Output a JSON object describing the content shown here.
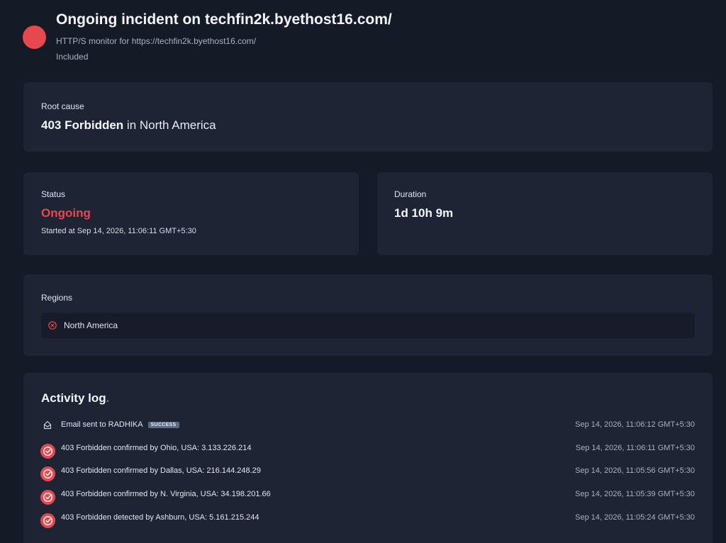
{
  "header": {
    "title": "Ongoing incident on techfin2k.byethost16.com/",
    "subtitle": "HTTP/S monitor for https://techfin2k.byethost16.com/",
    "included": "Included",
    "status_color": "#e5484d"
  },
  "root_cause": {
    "label": "Root cause",
    "error": "403 Forbidden",
    "connector": "in",
    "region": "North America"
  },
  "status": {
    "label": "Status",
    "value": "Ongoing",
    "started_at": "Started at Sep 14, 2026, 11:06:11 GMT+5:30",
    "color": "#e5484d"
  },
  "duration": {
    "label": "Duration",
    "value": "1d 10h 9m"
  },
  "regions": {
    "label": "Regions",
    "items": [
      {
        "name": "North America",
        "icon": "x-circle-icon"
      }
    ]
  },
  "activity_log": {
    "title": "Activity log",
    "title_suffix": ".",
    "items": [
      {
        "icon": "mail-icon",
        "text": "Email sent to RADHIKA",
        "badge": "SUCCESS",
        "time": "Sep 14, 2026, 11:06:12 GMT+5:30"
      },
      {
        "icon": "check-circle-icon",
        "text": "403 Forbidden confirmed by Ohio, USA: 3.133.226.214",
        "time": "Sep 14, 2026, 11:06:11 GMT+5:30"
      },
      {
        "icon": "check-circle-icon",
        "text": "403 Forbidden confirmed by Dallas, USA: 216.144.248.29",
        "time": "Sep 14, 2026, 11:05:56 GMT+5:30"
      },
      {
        "icon": "check-circle-icon",
        "text": "403 Forbidden confirmed by N. Virginia, USA: 34.198.201.66",
        "time": "Sep 14, 2026, 11:05:39 GMT+5:30"
      },
      {
        "icon": "check-circle-icon",
        "text": "403 Forbidden detected by Ashburn, USA: 5.161.215.244",
        "time": "Sep 14, 2026, 11:05:24 GMT+5:30"
      }
    ]
  }
}
